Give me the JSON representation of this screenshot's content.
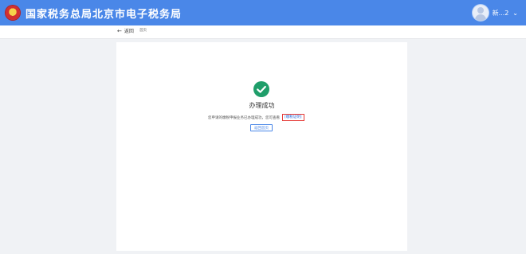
{
  "header": {
    "site_title": "国家税务总局北京市电子税务局",
    "user_name": "新...2",
    "dropdown_icon": "chevron-down-icon",
    "bg_color": "#4a87e8"
  },
  "subbar": {
    "back_label": "返回",
    "breadcrumb": "首页"
  },
  "result": {
    "status_icon": "check-circle-icon",
    "status_color": "#1f9e6a",
    "title": "办理成功",
    "message": "您申请的缴税申报业务已办理成功，您可查看",
    "link_label": "[缴税证明]",
    "home_button": "返回首页"
  }
}
